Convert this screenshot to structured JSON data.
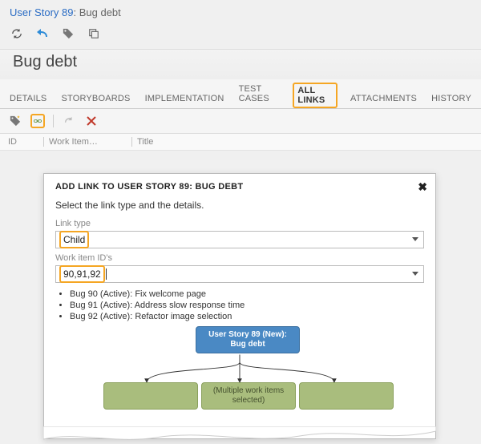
{
  "header": {
    "item_ref": "User Story 89",
    "item_title": "Bug debt"
  },
  "title": "Bug debt",
  "tabs": {
    "details": "DETAILS",
    "storyboards": "STORYBOARDS",
    "implementation": "IMPLEMENTATION",
    "testcases": "TEST CASES",
    "alllinks": "ALL LINKS",
    "attachments": "ATTACHMENTS",
    "history": "HISTORY"
  },
  "grid": {
    "col_id": "ID",
    "col_wi": "Work Item…",
    "col_title": "Title"
  },
  "dialog": {
    "heading": "ADD LINK TO USER STORY 89: BUG DEBT",
    "instruction": "Select the link type and the details.",
    "link_type_label": "Link type",
    "link_type_value": "Child",
    "ids_label": "Work item ID's",
    "ids_value": "90,91,92",
    "preview": [
      "Bug 90 (Active): Fix welcome page",
      "Bug 91 (Active): Address slow response time",
      "Bug 92 (Active): Refactor image selection"
    ],
    "diagram": {
      "parent": "User Story 89 (New): Bug debt",
      "child_label": "(Multiple work items selected)"
    }
  }
}
